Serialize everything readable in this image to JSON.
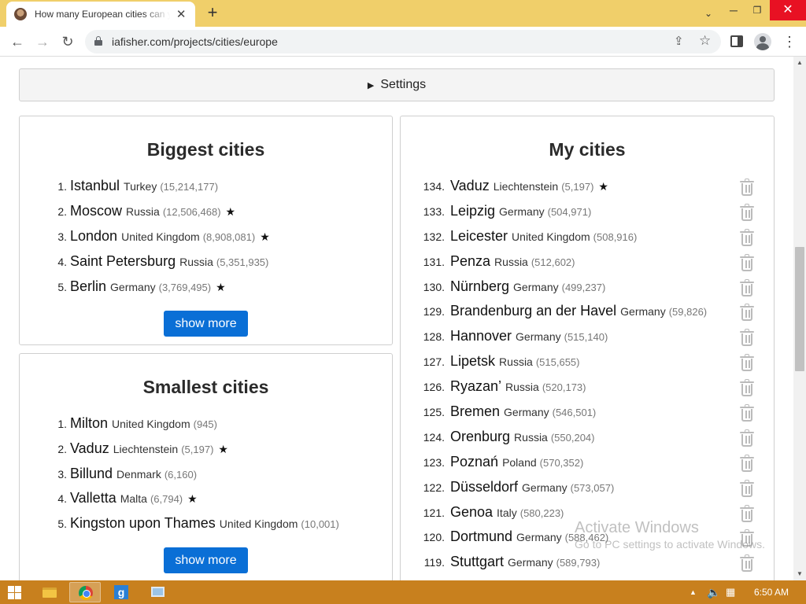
{
  "browser": {
    "tab_title": "How many European cities can you name?",
    "tab_close": "✕",
    "new_tab": "+",
    "url": "iafisher.com/projects/cities/europe",
    "window": {
      "tab_search": "⌄",
      "minimize": "─",
      "maximize": "❐",
      "close": "✕"
    },
    "nav": {
      "back": "←",
      "forward": "→",
      "reload": "↻",
      "share": "⇪",
      "bookmark": "☆",
      "menu": "⋮"
    }
  },
  "settings": {
    "toggle": "▶",
    "label": "Settings"
  },
  "biggest": {
    "title": "Biggest cities",
    "show_more": "show more",
    "rows": [
      {
        "n": "1.",
        "city": "Istanbul",
        "country": "Turkey",
        "pop": "(15,214,177)",
        "star": ""
      },
      {
        "n": "2.",
        "city": "Moscow",
        "country": "Russia",
        "pop": "(12,506,468)",
        "star": "★"
      },
      {
        "n": "3.",
        "city": "London",
        "country": "United Kingdom",
        "pop": "(8,908,081)",
        "star": "★"
      },
      {
        "n": "4.",
        "city": "Saint Petersburg",
        "country": "Russia",
        "pop": "(5,351,935)",
        "star": ""
      },
      {
        "n": "5.",
        "city": "Berlin",
        "country": "Germany",
        "pop": "(3,769,495)",
        "star": "★"
      }
    ]
  },
  "smallest": {
    "title": "Smallest cities",
    "show_more": "show more",
    "rows": [
      {
        "n": "1.",
        "city": "Milton",
        "country": "United Kingdom",
        "pop": "(945)",
        "star": ""
      },
      {
        "n": "2.",
        "city": "Vaduz",
        "country": "Liechtenstein",
        "pop": "(5,197)",
        "star": "★"
      },
      {
        "n": "3.",
        "city": "Billund",
        "country": "Denmark",
        "pop": "(6,160)",
        "star": ""
      },
      {
        "n": "4.",
        "city": "Valletta",
        "country": "Malta",
        "pop": "(6,794)",
        "star": "★"
      },
      {
        "n": "5.",
        "city": "Kingston upon Thames",
        "country": "United Kingdom",
        "pop": "(10,001)",
        "star": ""
      }
    ]
  },
  "my_cities": {
    "title": "My cities",
    "rows": [
      {
        "n": "134.",
        "city": "Vaduz",
        "country": "Liechtenstein",
        "pop": "(5,197)",
        "star": "★"
      },
      {
        "n": "133.",
        "city": "Leipzig",
        "country": "Germany",
        "pop": "(504,971)",
        "star": ""
      },
      {
        "n": "132.",
        "city": "Leicester",
        "country": "United Kingdom",
        "pop": "(508,916)",
        "star": ""
      },
      {
        "n": "131.",
        "city": "Penza",
        "country": "Russia",
        "pop": "(512,602)",
        "star": ""
      },
      {
        "n": "130.",
        "city": "Nürnberg",
        "country": "Germany",
        "pop": "(499,237)",
        "star": ""
      },
      {
        "n": "129.",
        "city": "Brandenburg an der Havel",
        "country": "Germany",
        "pop": "(59,826)",
        "star": ""
      },
      {
        "n": "128.",
        "city": "Hannover",
        "country": "Germany",
        "pop": "(515,140)",
        "star": ""
      },
      {
        "n": "127.",
        "city": "Lipetsk",
        "country": "Russia",
        "pop": "(515,655)",
        "star": ""
      },
      {
        "n": "126.",
        "city": "Ryazan’",
        "country": "Russia",
        "pop": "(520,173)",
        "star": ""
      },
      {
        "n": "125.",
        "city": "Bremen",
        "country": "Germany",
        "pop": "(546,501)",
        "star": ""
      },
      {
        "n": "124.",
        "city": "Orenburg",
        "country": "Russia",
        "pop": "(550,204)",
        "star": ""
      },
      {
        "n": "123.",
        "city": "Poznań",
        "country": "Poland",
        "pop": "(570,352)",
        "star": ""
      },
      {
        "n": "122.",
        "city": "Düsseldorf",
        "country": "Germany",
        "pop": "(573,057)",
        "star": ""
      },
      {
        "n": "121.",
        "city": "Genoa",
        "country": "Italy",
        "pop": "(580,223)",
        "star": ""
      },
      {
        "n": "120.",
        "city": "Dortmund",
        "country": "Germany",
        "pop": "(588,462)",
        "star": ""
      },
      {
        "n": "119.",
        "city": "Stuttgart",
        "country": "Germany",
        "pop": "(589,793)",
        "star": ""
      }
    ]
  },
  "watermark": {
    "line1": "Activate Windows",
    "line2": "Go to PC settings to activate Windows."
  },
  "taskbar": {
    "clock": "6:50 AM",
    "tray_up": "▲",
    "speaker": "🔈",
    "network": "▦"
  },
  "icons": {
    "trash": "trash-icon",
    "lock": "lock-icon",
    "star": "star-icon",
    "favicon": "favicon-icon",
    "profile": "profile-icon",
    "side_panel": "side-panel-icon"
  },
  "colors": {
    "tab_strip": "#f0cf6a",
    "accent_button": "#0a6fd6",
    "taskbar": "#c8801e"
  }
}
